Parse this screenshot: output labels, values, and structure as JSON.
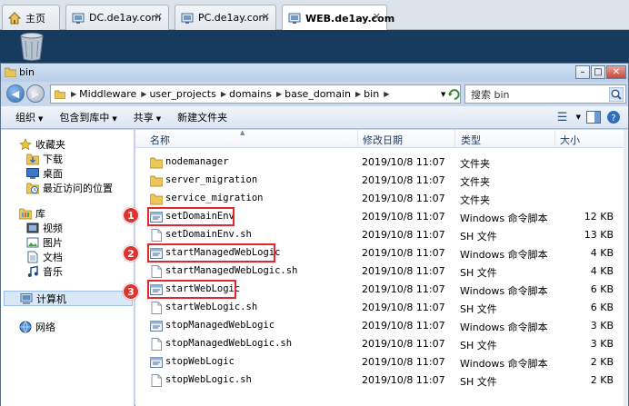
{
  "browser_tabs": [
    {
      "label": "主页",
      "icon": "home-icon"
    },
    {
      "label": "DC.de1ay.com",
      "icon": "vm-icon"
    },
    {
      "label": "PC.de1ay.com",
      "icon": "vm-icon"
    },
    {
      "label": "WEB.de1ay.com",
      "icon": "vm-icon",
      "active": true
    }
  ],
  "window": {
    "title": "bin"
  },
  "address": {
    "crumbs": [
      "Middleware",
      "user_projects",
      "domains",
      "base_domain",
      "bin"
    ],
    "search_placeholder": "搜索 bin"
  },
  "toolbar": {
    "organize": "组织",
    "include_in_library": "包含到库中",
    "share": "共享",
    "new_folder": "新建文件夹"
  },
  "nav": {
    "favorites": "收藏夹",
    "downloads": "下载",
    "desktop": "桌面",
    "recent": "最近访问的位置",
    "libraries": "库",
    "videos": "视频",
    "pictures": "图片",
    "documents": "文档",
    "music": "音乐",
    "computer": "计算机",
    "network": "网络"
  },
  "columns": {
    "name": "名称",
    "modified": "修改日期",
    "type": "类型",
    "size": "大小"
  },
  "files": [
    {
      "name": "nodemanager",
      "date": "2019/10/8 11:07",
      "type": "文件夹",
      "size": "",
      "kind": "folder"
    },
    {
      "name": "server_migration",
      "date": "2019/10/8 11:07",
      "type": "文件夹",
      "size": "",
      "kind": "folder"
    },
    {
      "name": "service_migration",
      "date": "2019/10/8 11:07",
      "type": "文件夹",
      "size": "",
      "kind": "folder"
    },
    {
      "name": "setDomainEnv",
      "date": "2019/10/8 11:07",
      "type": "Windows 命令脚本",
      "size": "12 KB",
      "kind": "cmd"
    },
    {
      "name": "setDomainEnv.sh",
      "date": "2019/10/8 11:07",
      "type": "SH 文件",
      "size": "13 KB",
      "kind": "sh"
    },
    {
      "name": "startManagedWebLogic",
      "date": "2019/10/8 11:07",
      "type": "Windows 命令脚本",
      "size": "4 KB",
      "kind": "cmd"
    },
    {
      "name": "startManagedWebLogic.sh",
      "date": "2019/10/8 11:07",
      "type": "SH 文件",
      "size": "4 KB",
      "kind": "sh"
    },
    {
      "name": "startWebLogic",
      "date": "2019/10/8 11:07",
      "type": "Windows 命令脚本",
      "size": "6 KB",
      "kind": "cmd"
    },
    {
      "name": "startWebLogic.sh",
      "date": "2019/10/8 11:07",
      "type": "SH 文件",
      "size": "6 KB",
      "kind": "sh"
    },
    {
      "name": "stopManagedWebLogic",
      "date": "2019/10/8 11:07",
      "type": "Windows 命令脚本",
      "size": "3 KB",
      "kind": "cmd"
    },
    {
      "name": "stopManagedWebLogic.sh",
      "date": "2019/10/8 11:07",
      "type": "SH 文件",
      "size": "3 KB",
      "kind": "sh"
    },
    {
      "name": "stopWebLogic",
      "date": "2019/10/8 11:07",
      "type": "Windows 命令脚本",
      "size": "2 KB",
      "kind": "cmd"
    },
    {
      "name": "stopWebLogic.sh",
      "date": "2019/10/8 11:07",
      "type": "SH 文件",
      "size": "2 KB",
      "kind": "sh"
    }
  ],
  "annotations": [
    "1",
    "2",
    "3"
  ],
  "colors": {
    "highlight": "#e0282d",
    "marker": "#e0322f"
  }
}
